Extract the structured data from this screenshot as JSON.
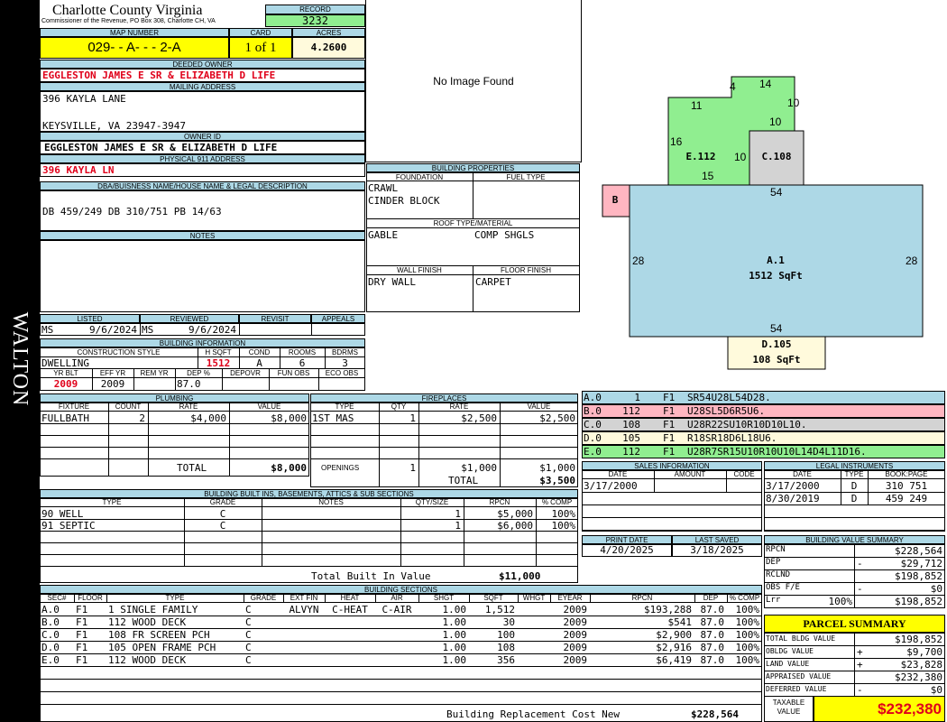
{
  "side_label": "WALTON",
  "header": {
    "county": "Charlotte County Virginia",
    "commissioner": "Commissioner of the Revenue, PO Box 308, Charlotte CH, VA",
    "record_label": "RECORD",
    "record": "3232"
  },
  "map": {
    "map_number_label": "MAP NUMBER",
    "map_number": "029- - A- - - 2-A",
    "card_label": "CARD",
    "card": "1 of 1",
    "acres_label": "ACRES",
    "acres": "4.2600"
  },
  "owner": {
    "deeded_owner_label": "DEEDED OWNER",
    "deeded_owner": "EGGLESTON JAMES E SR & ELIZABETH D LIFE",
    "mailing_label": "MAILING ADDRESS",
    "mailing_line1": "396 KAYLA LANE",
    "mailing_line2": "KEYSVILLE, VA 23947-3947",
    "owner_id_label": "OWNER ID",
    "owner_id": "EGGLESTON JAMES E SR & ELIZABETH D LIFE",
    "physical_label": "PHYSICAL 911 ADDRESS",
    "physical": "396 KAYLA LN",
    "dba_label": "DBA/BUISNESS NAME/HOUSE NAME & LEGAL DESCRIPTION",
    "dba": "DB 459/249 DB 310/751 PB 14/63",
    "notes_label": "NOTES"
  },
  "image": {
    "text": "No Image Found"
  },
  "building_properties": {
    "title": "BUILDING PROPERTIES",
    "foundation_label": "FOUNDATION",
    "foundation1": "CRAWL",
    "foundation2": "CINDER BLOCK",
    "fuel_label": "FUEL TYPE",
    "roof_label": "ROOF TYPE/MATERIAL",
    "roof_type": "GABLE",
    "roof_material": "COMP SHGLS",
    "wall_label": "WALL FINISH",
    "wall": "DRY WALL",
    "floor_label": "FLOOR FINISH",
    "floor": "CARPET"
  },
  "listing": {
    "listed_label": "LISTED",
    "listed_code": "MS",
    "listed_date": "9/6/2024",
    "reviewed_label": "REVIEWED",
    "reviewed_code": "MS",
    "reviewed_date": "9/6/2024",
    "revisit_label": "REVISIT",
    "appeals_label": "APPEALS"
  },
  "building_info": {
    "title": "BUILDING INFORMATION",
    "style_label": "CONSTRUCTION STYLE",
    "style": "DWELLING",
    "hsqft_label": "H SQFT",
    "hsqft": "1512",
    "cond_label": "COND",
    "cond": "A",
    "rooms_label": "ROOMS",
    "rooms": "6",
    "bdrms_label": "BDRMS",
    "bdrms": "3",
    "yrblt_label": "YR BLT",
    "yrblt": "2009",
    "effyr_label": "EFF YR",
    "effyr": "2009",
    "remyr_label": "REM YR",
    "dep_label": "DEP %",
    "dep": "87.0",
    "depovr_label": "DEPOVR",
    "funobs_label": "FUN OBS",
    "ecoobs_label": "ECO OBS"
  },
  "plumbing": {
    "title": "PLUMBING",
    "headers": [
      "FIXTURE",
      "COUNT",
      "RATE",
      "VALUE"
    ],
    "rows": [
      [
        "FULLBATH",
        "2",
        "$4,000",
        "$8,000"
      ]
    ],
    "total_label": "TOTAL",
    "total": "$8,000"
  },
  "fireplaces": {
    "title": "FIREPLACES",
    "headers": [
      "TYPE",
      "QTY",
      "RATE",
      "VALUE"
    ],
    "rows": [
      [
        "1ST MAS",
        "1",
        "$2,500",
        "$2,500"
      ]
    ],
    "openings_label": "OPENINGS",
    "openings_qty": "1",
    "openings_rate": "$1,000",
    "openings_value": "$1,000",
    "total_label": "TOTAL",
    "total": "$3,500"
  },
  "built_ins": {
    "title": "BUILDING BUILT INS, BASEMENTS, ATTICS & SUB SECTIONS",
    "headers": [
      "TYPE",
      "GRADE",
      "NOTES",
      "QTY/SIZE",
      "RPCN",
      "% COMP"
    ],
    "rows": [
      [
        "90 WELL",
        "C",
        "",
        "1",
        "$5,000",
        "100%"
      ],
      [
        "91 SEPTIC",
        "C",
        "",
        "1",
        "$6,000",
        "100%"
      ]
    ],
    "total_label": "Total Built In Value",
    "total": "$11,000"
  },
  "sketch": {
    "labels": {
      "e_code": "E.112",
      "c_code": "C.108",
      "b_code": "B",
      "a_code": "A.1",
      "a_area": "1512 SqFt",
      "d_code": "D.105",
      "d_area": "108 SqFt"
    },
    "dims": {
      "e4": "4",
      "e14": "14",
      "e11": "11",
      "e10a": "10",
      "e10b": "10",
      "e16": "16",
      "e10c": "10",
      "e15": "15",
      "a54top": "54",
      "a28left": "28",
      "a28right": "28",
      "a54bot": "54"
    }
  },
  "sketch_vectors": [
    {
      "code": "A.0",
      "sqft": "1",
      "floor": "F1",
      "vector": "SR54U28L54D28.",
      "color": "#add8e6"
    },
    {
      "code": "B.0",
      "sqft": "112",
      "floor": "F1",
      "vector": "U28SL5D6R5U6.",
      "color": "#ffb6c1"
    },
    {
      "code": "C.0",
      "sqft": "108",
      "floor": "F1",
      "vector": "U28R22SU10R10D10L10.",
      "color": "#d3d3d3"
    },
    {
      "code": "D.0",
      "sqft": "105",
      "floor": "F1",
      "vector": "R18SR18D6L18U6.",
      "color": "#fffadc"
    },
    {
      "code": "E.0",
      "sqft": "112",
      "floor": "F1",
      "vector": "U28R7SR15U10R10U10L14D4L11D16.",
      "color": "#90ee90"
    }
  ],
  "sales": {
    "title": "SALES INFORMATION",
    "headers": [
      "DATE",
      "AMOUNT",
      "CODE"
    ],
    "rows": [
      [
        "3/17/2000",
        "",
        ""
      ]
    ]
  },
  "legal": {
    "title": "LEGAL INSTRUMENTS",
    "headers": [
      "DATE",
      "TYPE",
      "BOOK:PAGE"
    ],
    "rows": [
      [
        "3/17/2000",
        "D",
        "310 751"
      ],
      [
        "8/30/2019",
        "D",
        "459 249"
      ]
    ]
  },
  "print": {
    "print_label": "PRINT DATE",
    "print_date": "4/20/2025",
    "saved_label": "LAST SAVED",
    "saved_date": "3/18/2025"
  },
  "value_summary": {
    "title": "BUILDING VALUE SUMMARY",
    "rows": [
      {
        "label": "RPCN",
        "sign": "",
        "pct": "",
        "value": "$228,564"
      },
      {
        "label": "DEP",
        "sign": "-",
        "pct": "",
        "value": "$29,712"
      },
      {
        "label": "RCLND",
        "sign": "",
        "pct": "",
        "value": "$198,852"
      },
      {
        "label": "OBS F/E",
        "sign": "-",
        "pct": "",
        "value": "$0"
      },
      {
        "label": "Lrr",
        "sign": "",
        "pct": "100%",
        "value": "$198,852"
      }
    ]
  },
  "parcel_summary": {
    "title": "PARCEL SUMMARY",
    "rows": [
      {
        "label": "TOTAL BLDG VALUE",
        "sign": "",
        "value": "$198,852"
      },
      {
        "label": "OBLDG VALUE",
        "sign": "+",
        "value": "$9,700"
      },
      {
        "label": "LAND VALUE",
        "sign": "+",
        "value": "$23,828"
      },
      {
        "label": "APPRAISED VALUE",
        "sign": "",
        "value": "$232,380"
      },
      {
        "label": "DEFERRED VALUE",
        "sign": "-",
        "value": "$0"
      }
    ],
    "taxable_label1": "TAXABLE",
    "taxable_label2": "VALUE",
    "taxable": "$232,380"
  },
  "sections": {
    "title": "BUILDING SECTIONS",
    "headers": [
      "SEC#",
      "FLOOR",
      "TYPE",
      "GRADE",
      "EXT FIN",
      "HEAT",
      "AIR",
      "SHGT",
      "SQFT",
      "WHGT",
      "EYEAR",
      "RPCN",
      "DEP",
      "% COMP"
    ],
    "rows": [
      [
        "A.0",
        "F1",
        "1 SINGLE FAMILY",
        "C",
        "ALVYN",
        "C-HEAT",
        "C-AIR",
        "1.00",
        "1,512",
        "",
        "2009",
        "$193,288",
        "87.0",
        "100%"
      ],
      [
        "B.0",
        "F1",
        "112 WOOD DECK",
        "C",
        "",
        "",
        "",
        "1.00",
        "30",
        "",
        "2009",
        "$541",
        "87.0",
        "100%"
      ],
      [
        "C.0",
        "F1",
        "108 FR SCREEN PCH",
        "C",
        "",
        "",
        "",
        "1.00",
        "100",
        "",
        "2009",
        "$2,900",
        "87.0",
        "100%"
      ],
      [
        "D.0",
        "F1",
        "105 OPEN FRAME PCH",
        "C",
        "",
        "",
        "",
        "1.00",
        "108",
        "",
        "2009",
        "$2,916",
        "87.0",
        "100%"
      ],
      [
        "E.0",
        "F1",
        "112 WOOD DECK",
        "C",
        "",
        "",
        "",
        "1.00",
        "356",
        "",
        "2009",
        "$6,419",
        "87.0",
        "100%"
      ]
    ],
    "total_label": "Building Replacement Cost New",
    "total": "$228,564"
  },
  "colors": {
    "header_blue": "#add8e6",
    "highlight_yellow": "#ffff00",
    "record_green": "#90ee90",
    "red_text": "#e0001a"
  }
}
